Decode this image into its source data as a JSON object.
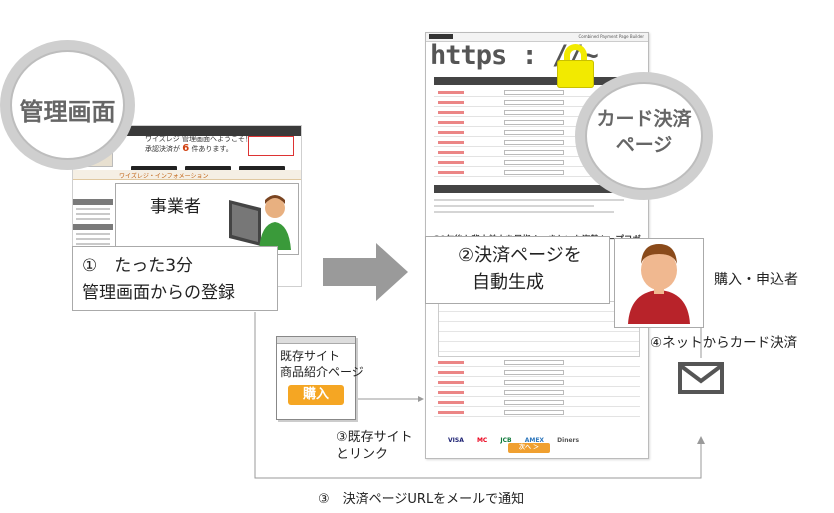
{
  "labels": {
    "admin_badge": "管理画面",
    "payment_badge_line1": "カード決済",
    "payment_badge_line2": "ページ",
    "business_operator": "事業者",
    "step1_line1": "①　たった3分",
    "step1_line2": "管理画面からの登録",
    "step2_line1": "②決済ページを",
    "step2_line2": "自動生成",
    "purchaser": "購入・申込者",
    "step4": "④ネットからカード決済",
    "existing_site_line1": "既存サイト",
    "existing_site_line2": "商品紹介ページ",
    "buy_button": "購入",
    "step3_link_line1": "③既存サイト",
    "step3_link_line2": "とリンク",
    "step3_email": "③　決済ページURLをメールで通知",
    "url": "https : //~"
  },
  "admin_mock": {
    "welcome": "ワイズレジ 管理画面へようこそ！",
    "count_prefix": "承認決済が",
    "count_value": "6",
    "count_suffix": "件あります。",
    "info_bar": "ワイズレジ・インフォメーション"
  },
  "payment_mock": {
    "header_right": "Combined Payment Page Builder",
    "headline": "30年後も背中美人を目指す　きれいな姿勢キープヨガ",
    "card_brands": [
      "VISA",
      "MC",
      "JCB",
      "AMEX",
      "Diners"
    ],
    "next_button": "次へ ＞"
  },
  "colors": {
    "arrow_gray": "#9a9a9a",
    "badge_gray": "#666666",
    "buy_button": "#f5a623",
    "lock_yellow": "#f2ea00",
    "customer_shirt": "#b8232a",
    "operator_shirt": "#3a9a3a"
  },
  "icons": [
    "padlock-icon",
    "person-icon",
    "mail-icon",
    "computer-icon"
  ]
}
